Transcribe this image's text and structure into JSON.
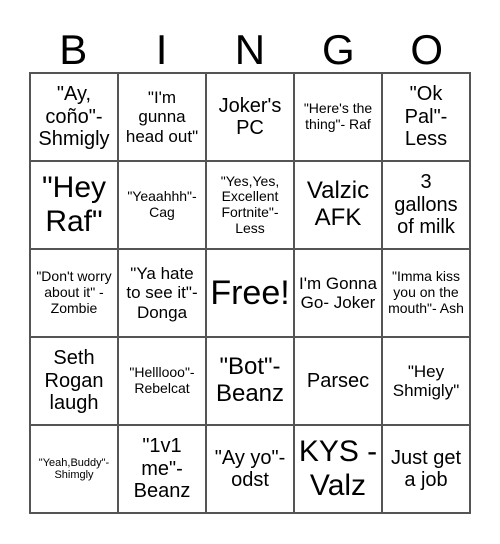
{
  "header": {
    "letters": [
      "B",
      "I",
      "N",
      "G",
      "O"
    ]
  },
  "cells": [
    [
      "\"Ay, coño\"- Shmigly",
      "\"I'm gunna head out\"",
      "Joker's PC",
      "\"Here's the thing\"- Raf",
      "\"Ok Pal\"- Less"
    ],
    [
      "\"Hey Raf\"",
      "\"Yeaahhh\"- Cag",
      "\"Yes,Yes, Excellent Fortnite\"- Less",
      "Valzic AFK",
      "3 gallons of milk"
    ],
    [
      "\"Don't worry about it\" - Zombie",
      "\"Ya hate to see it\"- Donga",
      "Free!",
      "I'm Gonna Go- Joker",
      "\"Imma kiss you on the mouth\"- Ash"
    ],
    [
      "Seth Rogan laugh",
      "\"Helllooo\"- Rebelcat",
      "\"Bot\"- Beanz",
      "Parsec",
      "\"Hey Shmigly\""
    ],
    [
      "\"Yeah,Buddy\"- Shimgly",
      "\"1v1 me\"- Beanz",
      "\"Ay yo\"- odst",
      "KYS -Valz",
      "Just get a job"
    ]
  ]
}
